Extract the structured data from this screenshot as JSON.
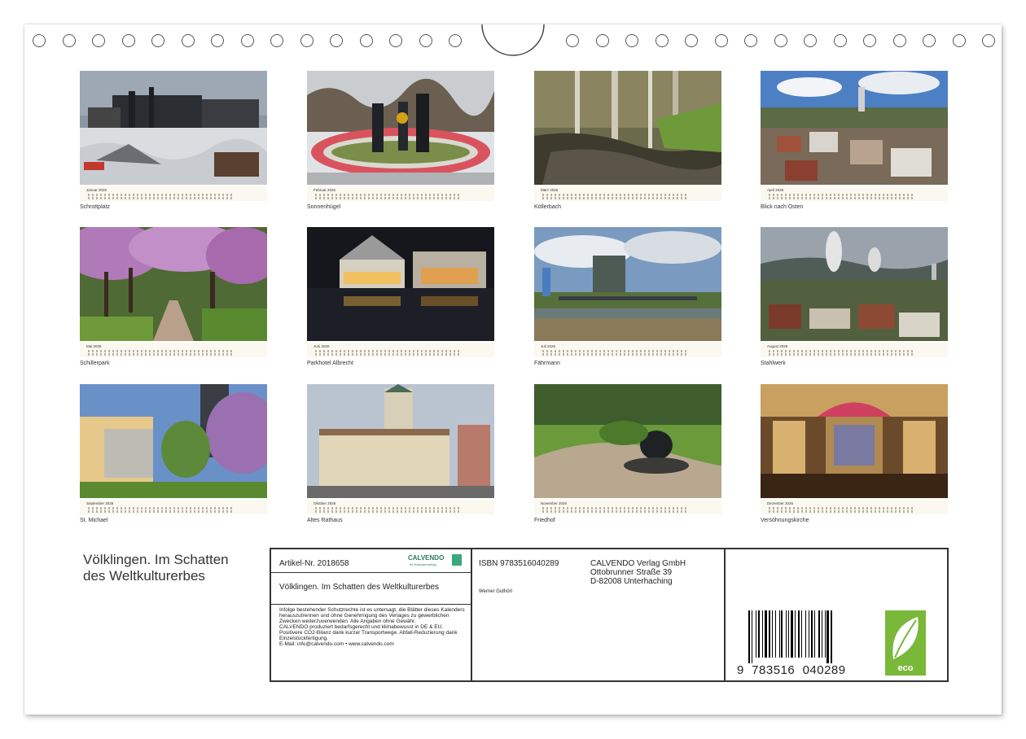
{
  "months": [
    {
      "name": "Januar 2026",
      "caption": "Schrottplatz"
    },
    {
      "name": "Februar 2026",
      "caption": "Sonnenhügel"
    },
    {
      "name": "März 2026",
      "caption": "Köllerbach"
    },
    {
      "name": "April 2026",
      "caption": "Blick nach Osten"
    },
    {
      "name": "Mai 2026",
      "caption": "Schillerpark"
    },
    {
      "name": "Juni 2026",
      "caption": "Parkhotel Albrecht"
    },
    {
      "name": "Juli 2026",
      "caption": "Fährmann"
    },
    {
      "name": "August 2026",
      "caption": "Stahlwerk"
    },
    {
      "name": "September 2026",
      "caption": "St. Michael"
    },
    {
      "name": "Oktober 2026",
      "caption": "Altes Rathaus"
    },
    {
      "name": "November 2026",
      "caption": "Friedhof"
    },
    {
      "name": "Dezember 2026",
      "caption": "Versöhnungskirche"
    }
  ],
  "title": "Völklingen. Im Schatten des Weltkulturerbes",
  "info": {
    "article_label": "Artikel-Nr. 2018658",
    "brand": "CALVENDO",
    "brand_sub": "Ihr Kalenderverlag",
    "product_title": "Völklingen. Im Schatten des Weltkulturerbes",
    "legal_text": "Infolge bestehender Schutzrechte ist es untersagt, die Blätter dieses Kalenders herauszutrennen und ohne Genehmigung des Verlages zu gewerblichen Zwecken weiterzuverwenden. Alle Angaben ohne Gewähr.",
    "eco_text": "CALVENDO produziert bedarfsgerecht und klimabewusst in DE & EU. Positivere CO2-Bilanz dank kurzer Transportwege. Abfall-Reduzierung dank Einzelstückfertigung.",
    "contact": "E-Mail: info@calvendo.com • www.calvendo.com",
    "isbn": "ISBN 9783516040289",
    "author": "Werner Guthörl",
    "publisher_name": "CALVENDO Verlag GmbH",
    "publisher_street": "Ottobrunner Straße 39",
    "publisher_city": "D-82008 Unterhaching",
    "barcode_digits": "9  783516  040289",
    "eco_label": "eco"
  }
}
